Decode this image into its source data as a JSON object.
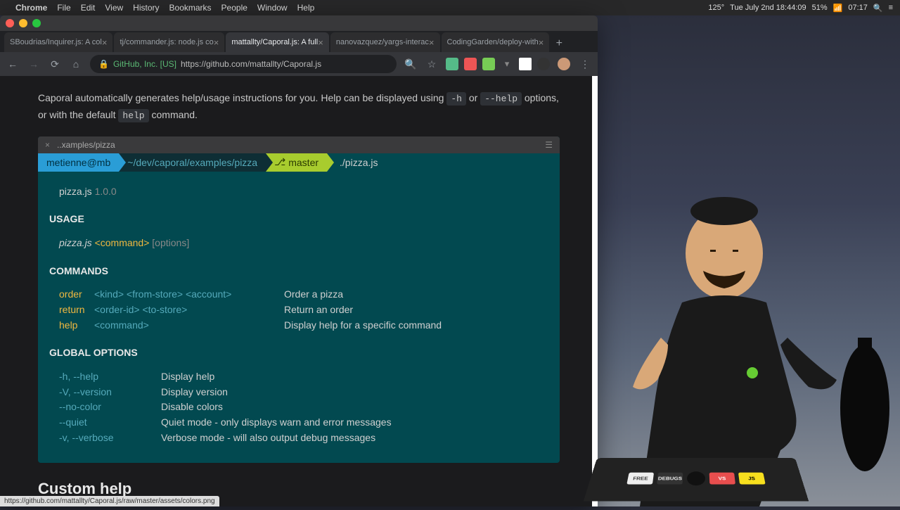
{
  "menubar": {
    "app": "Chrome",
    "items": [
      "File",
      "Edit",
      "View",
      "History",
      "Bookmarks",
      "People",
      "Window",
      "Help"
    ],
    "right": {
      "temp": "125°",
      "date": "Tue July 2nd 18:44:09",
      "battery": "51%",
      "clock": "07:17"
    }
  },
  "tabs": [
    {
      "label": "SBoudrias/Inquirer.js: A col"
    },
    {
      "label": "tj/commander.js: node.js co"
    },
    {
      "label": "mattallty/Caporal.js: A full",
      "active": true
    },
    {
      "label": "nanovazquez/yargs-interac"
    },
    {
      "label": "CodingGarden/deploy-with"
    }
  ],
  "address": {
    "org": "GitHub, Inc. [US]",
    "url": "https://github.com/mattallty/Caporal.js"
  },
  "intro": {
    "text1": "Caporal automatically generates help/usage instructions for you. Help can be displayed using ",
    "code1": "-h",
    "text2": " or ",
    "code2": "--help",
    "text3": " options, or with the default ",
    "code3": "help",
    "text4": " command."
  },
  "terminal": {
    "tab": "..xamples/pizza",
    "prompt": {
      "user": "metienne@mb",
      "path": "~/dev/caporal/examples/pizza",
      "branch": "master",
      "cmd": "./pizza.js"
    },
    "output": {
      "name": "pizza.js",
      "version": "1.0.0",
      "usage_label": "USAGE",
      "usage": {
        "exe": "pizza.js",
        "req": "<command>",
        "opt": "[options]"
      },
      "commands_label": "COMMANDS",
      "commands": [
        {
          "name": "order",
          "args": "<kind> <from-store> <account>",
          "desc": "Order a pizza"
        },
        {
          "name": "return",
          "args": "<order-id> <to-store>",
          "desc": "Return an order"
        },
        {
          "name": "help",
          "args": "<command>",
          "desc": "Display help for a specific command"
        }
      ],
      "global_label": "GLOBAL OPTIONS",
      "options": [
        {
          "flag": "-h, --help",
          "desc": "Display help"
        },
        {
          "flag": "-V, --version",
          "desc": "Display version"
        },
        {
          "flag": "--no-color",
          "desc": "Disable colors"
        },
        {
          "flag": "--quiet",
          "desc": "Quiet mode - only displays warn and error messages"
        },
        {
          "flag": "-v, --verbose",
          "desc": "Verbose mode - will also output debug messages"
        }
      ]
    }
  },
  "heading": "Custom help",
  "statusbar": "https://github.com/mattallty/Caporal.js/raw/master/assets/colors.png",
  "stickers": [
    {
      "label": "FREE",
      "bg": "#eee",
      "fg": "#333"
    },
    {
      "label": "DEBUGS",
      "bg": "#333",
      "fg": "#eee"
    },
    {
      "label": "VS",
      "bg": "#e84e4e",
      "fg": "#fff"
    },
    {
      "label": "JS",
      "bg": "#f7df1e",
      "fg": "#000"
    }
  ]
}
